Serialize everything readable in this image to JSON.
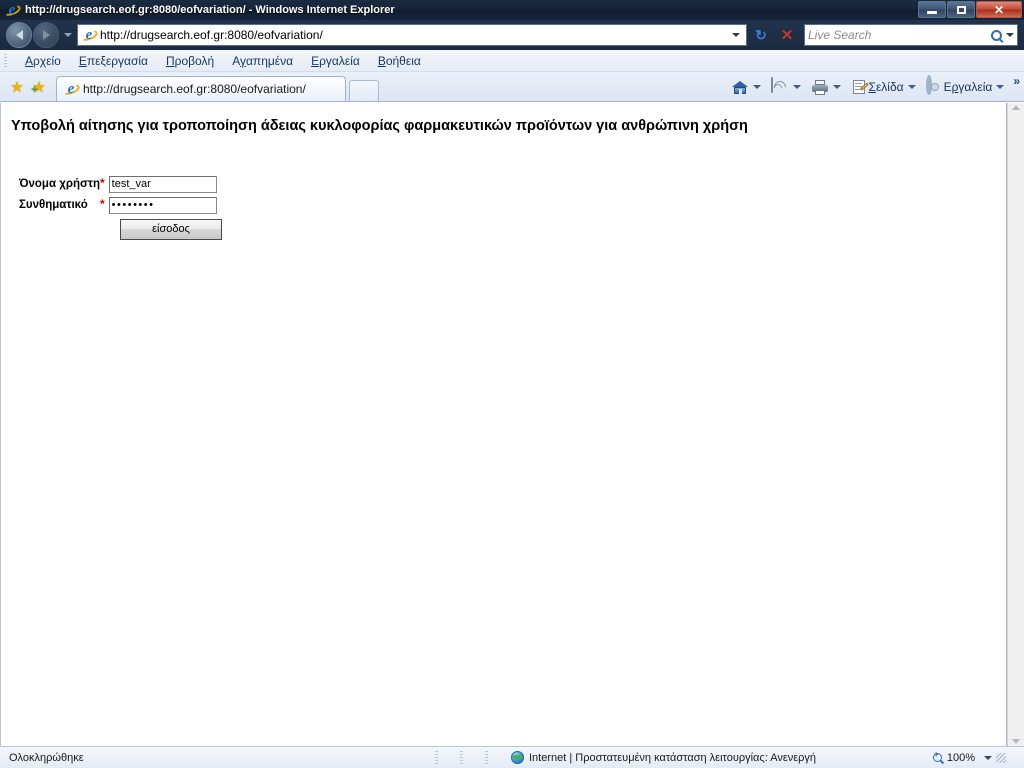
{
  "window": {
    "title": "http://drugsearch.eof.gr:8080/eofvariation/ - Windows Internet Explorer",
    "minimize_label": "Ελαχιστοποίηση",
    "restore_label": "Επαναφορά",
    "close_label": "Κλείσιμο",
    "app_icon": "ie-logo-icon"
  },
  "navigation": {
    "back_label": "Πίσω",
    "forward_label": "Εμπρός",
    "recent_pages_label": "Πρόσφατες σελίδες",
    "address_value": "http://drugsearch.eof.gr:8080/eofvariation/",
    "address_icon": "ie-logo-icon",
    "refresh_label": "Ανανέωση",
    "stop_label": "Διακοπή",
    "search": {
      "placeholder": "Live Search",
      "icon": "search-icon"
    }
  },
  "menubar": {
    "items": [
      {
        "label": "Αρχείο",
        "accel": "Α",
        "pre": "",
        "post": "ρχείο"
      },
      {
        "label": "Επεξεργασία",
        "accel": "Ε",
        "pre": "",
        "post": "πεξεργασία"
      },
      {
        "label": "Προβολή",
        "accel": "Π",
        "pre": "",
        "post": "ροβολή"
      },
      {
        "label": "Αγαπημένα",
        "accel": "γ",
        "pre": "Α",
        "post": "απημένα"
      },
      {
        "label": "Εργαλεία",
        "accel": "Ε",
        "pre": "",
        "post": "ργαλεία"
      },
      {
        "label": "Βοήθεια",
        "accel": "Β",
        "pre": "",
        "post": "οήθεια"
      }
    ]
  },
  "tabbar": {
    "favorites_center_label": "Κέντρο αγαπημένων",
    "add_favorites_label": "Προσθήκη στα αγαπημένα",
    "tabs": [
      {
        "label": "http://drugsearch.eof.gr:8080/eofvariation/",
        "icon": "ie-logo-icon",
        "active": true
      }
    ],
    "new_tab_label": "Νέα καρτέλα"
  },
  "commandbar": {
    "home_label": "Κεντρική σελίδα",
    "feeds_label": "Τροφοδοσίες",
    "print_label": "Εκτύπωση",
    "page_label": "Σελίδα",
    "page_accel": "Σ",
    "tools_label": "Εργαλεία",
    "tools_accel": "ρ",
    "overflow_label": "»"
  },
  "page": {
    "heading": "Υποβολή αίτησης για τροποποίηση άδειας κυκλοφορίας φαρμακευτικών προϊόντων για ανθρώπινη χρήση",
    "form": {
      "username": {
        "label": "Όνομα χρήστη",
        "required_marker": "*",
        "value": "test_var",
        "placeholder": ""
      },
      "password": {
        "label": "Συνθηματικό",
        "required_marker": "*",
        "value": "••••••••",
        "placeholder": ""
      },
      "submit_label": "είσοδος"
    }
  },
  "scrollbar": {
    "up_label": "Κύλιση πάνω",
    "down_label": "Κύλιση κάτω"
  },
  "statusbar": {
    "status_text": "Ολοκληρώθηκε",
    "zone_icon": "internet-zone-icon",
    "zone_text": "Internet | Προστατευμένη κατάσταση λειτουργίας: Ανενεργή",
    "zoom_icon": "zoom-icon",
    "zoom_level": "100%"
  },
  "colors": {
    "titlebar": "#16253a",
    "chrome": "#e6ecf5",
    "accent_blue": "#17365d",
    "required_red": "#cc0000",
    "close_red": "#c54a36",
    "page_bg": "#ffffff"
  }
}
